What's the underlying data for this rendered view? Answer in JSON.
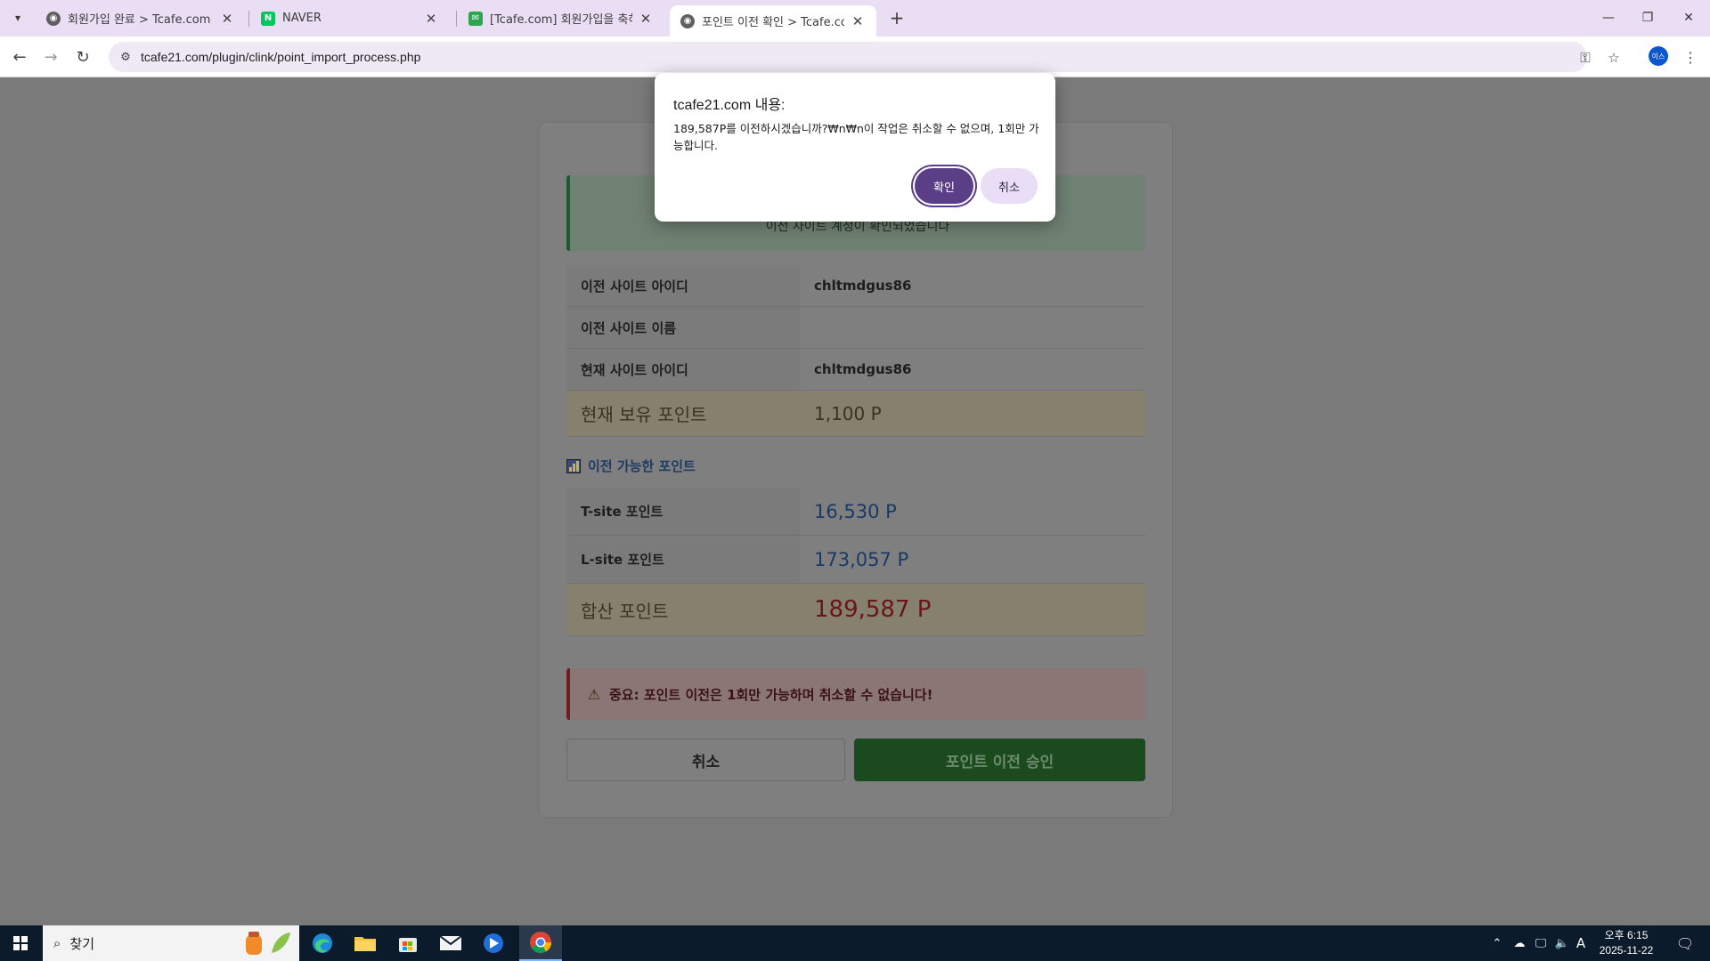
{
  "browser": {
    "tabs": [
      {
        "title": "회원가입 완료 > Tcafe.com",
        "icon": "globe-icon"
      },
      {
        "title": "NAVER",
        "icon": "naver-icon"
      },
      {
        "title": "[Tcafe.com] 회원가입을 축하드",
        "icon": "mail-icon"
      },
      {
        "title": "포인트 이전 확인 > Tcafe.com",
        "icon": "globe-icon",
        "active": true
      }
    ],
    "url": "tcafe21.com/plugin/clink/point_import_process.php",
    "profile_initials": "이스"
  },
  "page": {
    "success_message": "이전 사이트 계정이 확인되었습니다",
    "info_rows": [
      {
        "label": "이전 사이트 아이디",
        "value": "chltmdgus86"
      },
      {
        "label": "이전 사이트 이름",
        "value": ""
      },
      {
        "label": "현재 사이트 아이디",
        "value": "chltmdgus86"
      }
    ],
    "current_points": {
      "label": "현재 보유 포인트",
      "value": "1,100 P"
    },
    "section_title": "이전 가능한 포인트",
    "point_rows": [
      {
        "label": "T-site 포인트",
        "value": "16,530 P"
      },
      {
        "label": "L-site 포인트",
        "value": "173,057 P"
      }
    ],
    "total_points": {
      "label": "합산 포인트",
      "value": "189,587 P"
    },
    "warning": "중요: 포인트 이전은 1회만 가능하며 취소할 수 없습니다!",
    "cancel_label": "취소",
    "approve_label": "포인트 이전 승인"
  },
  "dialog": {
    "title": "tcafe21.com 내용:",
    "message": "189,587P를 이전하시겠습니까?₩n₩n이 작업은 취소할 수 없으며, 1회만 가능합니다.",
    "ok_label": "확인",
    "cancel_label": "취소"
  },
  "taskbar": {
    "search_label": "찾기",
    "clock_time": "오후 6:15",
    "clock_date": "2025-11-22",
    "ime_label": "A"
  },
  "colors": {
    "dialog_ok": "#5b3f86",
    "dialog_cancel": "#e9def6",
    "approve_button": "#1c4a1f",
    "points_blue": "#1a3a66",
    "points_red": "#6a1616"
  }
}
